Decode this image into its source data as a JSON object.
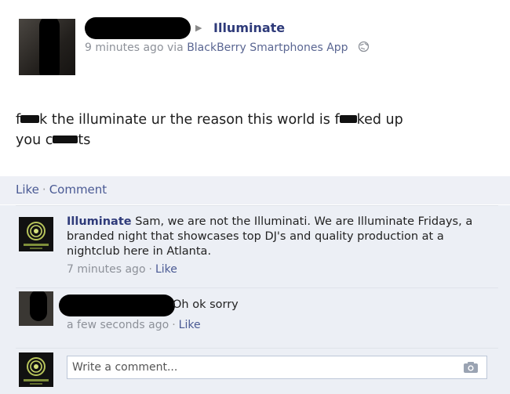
{
  "post": {
    "target_name": "Illuminate",
    "timestamp": "9 minutes ago",
    "via_prefix": "via",
    "app_name": "BlackBerry Smartphones App",
    "message_parts": [
      "f",
      "k the illuminate ur the reason this world is f",
      "ked up",
      "you c",
      "ts"
    ]
  },
  "actions": {
    "like": "Like",
    "separator": "·",
    "comment": "Comment"
  },
  "comments": [
    {
      "author": "Illuminate",
      "text": "Sam, we are not the Illuminati. We are Illuminate Fridays, a branded night that showcases top DJ's and quality production at a nightclub here in Atlanta.",
      "time": "7 minutes ago",
      "like": "Like"
    },
    {
      "text": "Oh ok sorry",
      "time": "a few seconds ago",
      "like": "Like"
    }
  ],
  "composer": {
    "placeholder": "Write a comment..."
  },
  "icons": {
    "arrow": "triangle-right-icon",
    "privacy": "globe-icon",
    "camera": "camera-icon",
    "page_logo": "illuminate-logo-icon"
  },
  "colors": {
    "link": "#2f3b7a",
    "action_link": "#4a5a94",
    "meta": "#8d9199",
    "comment_bg": "#eceff5",
    "redaction": "#000000"
  }
}
